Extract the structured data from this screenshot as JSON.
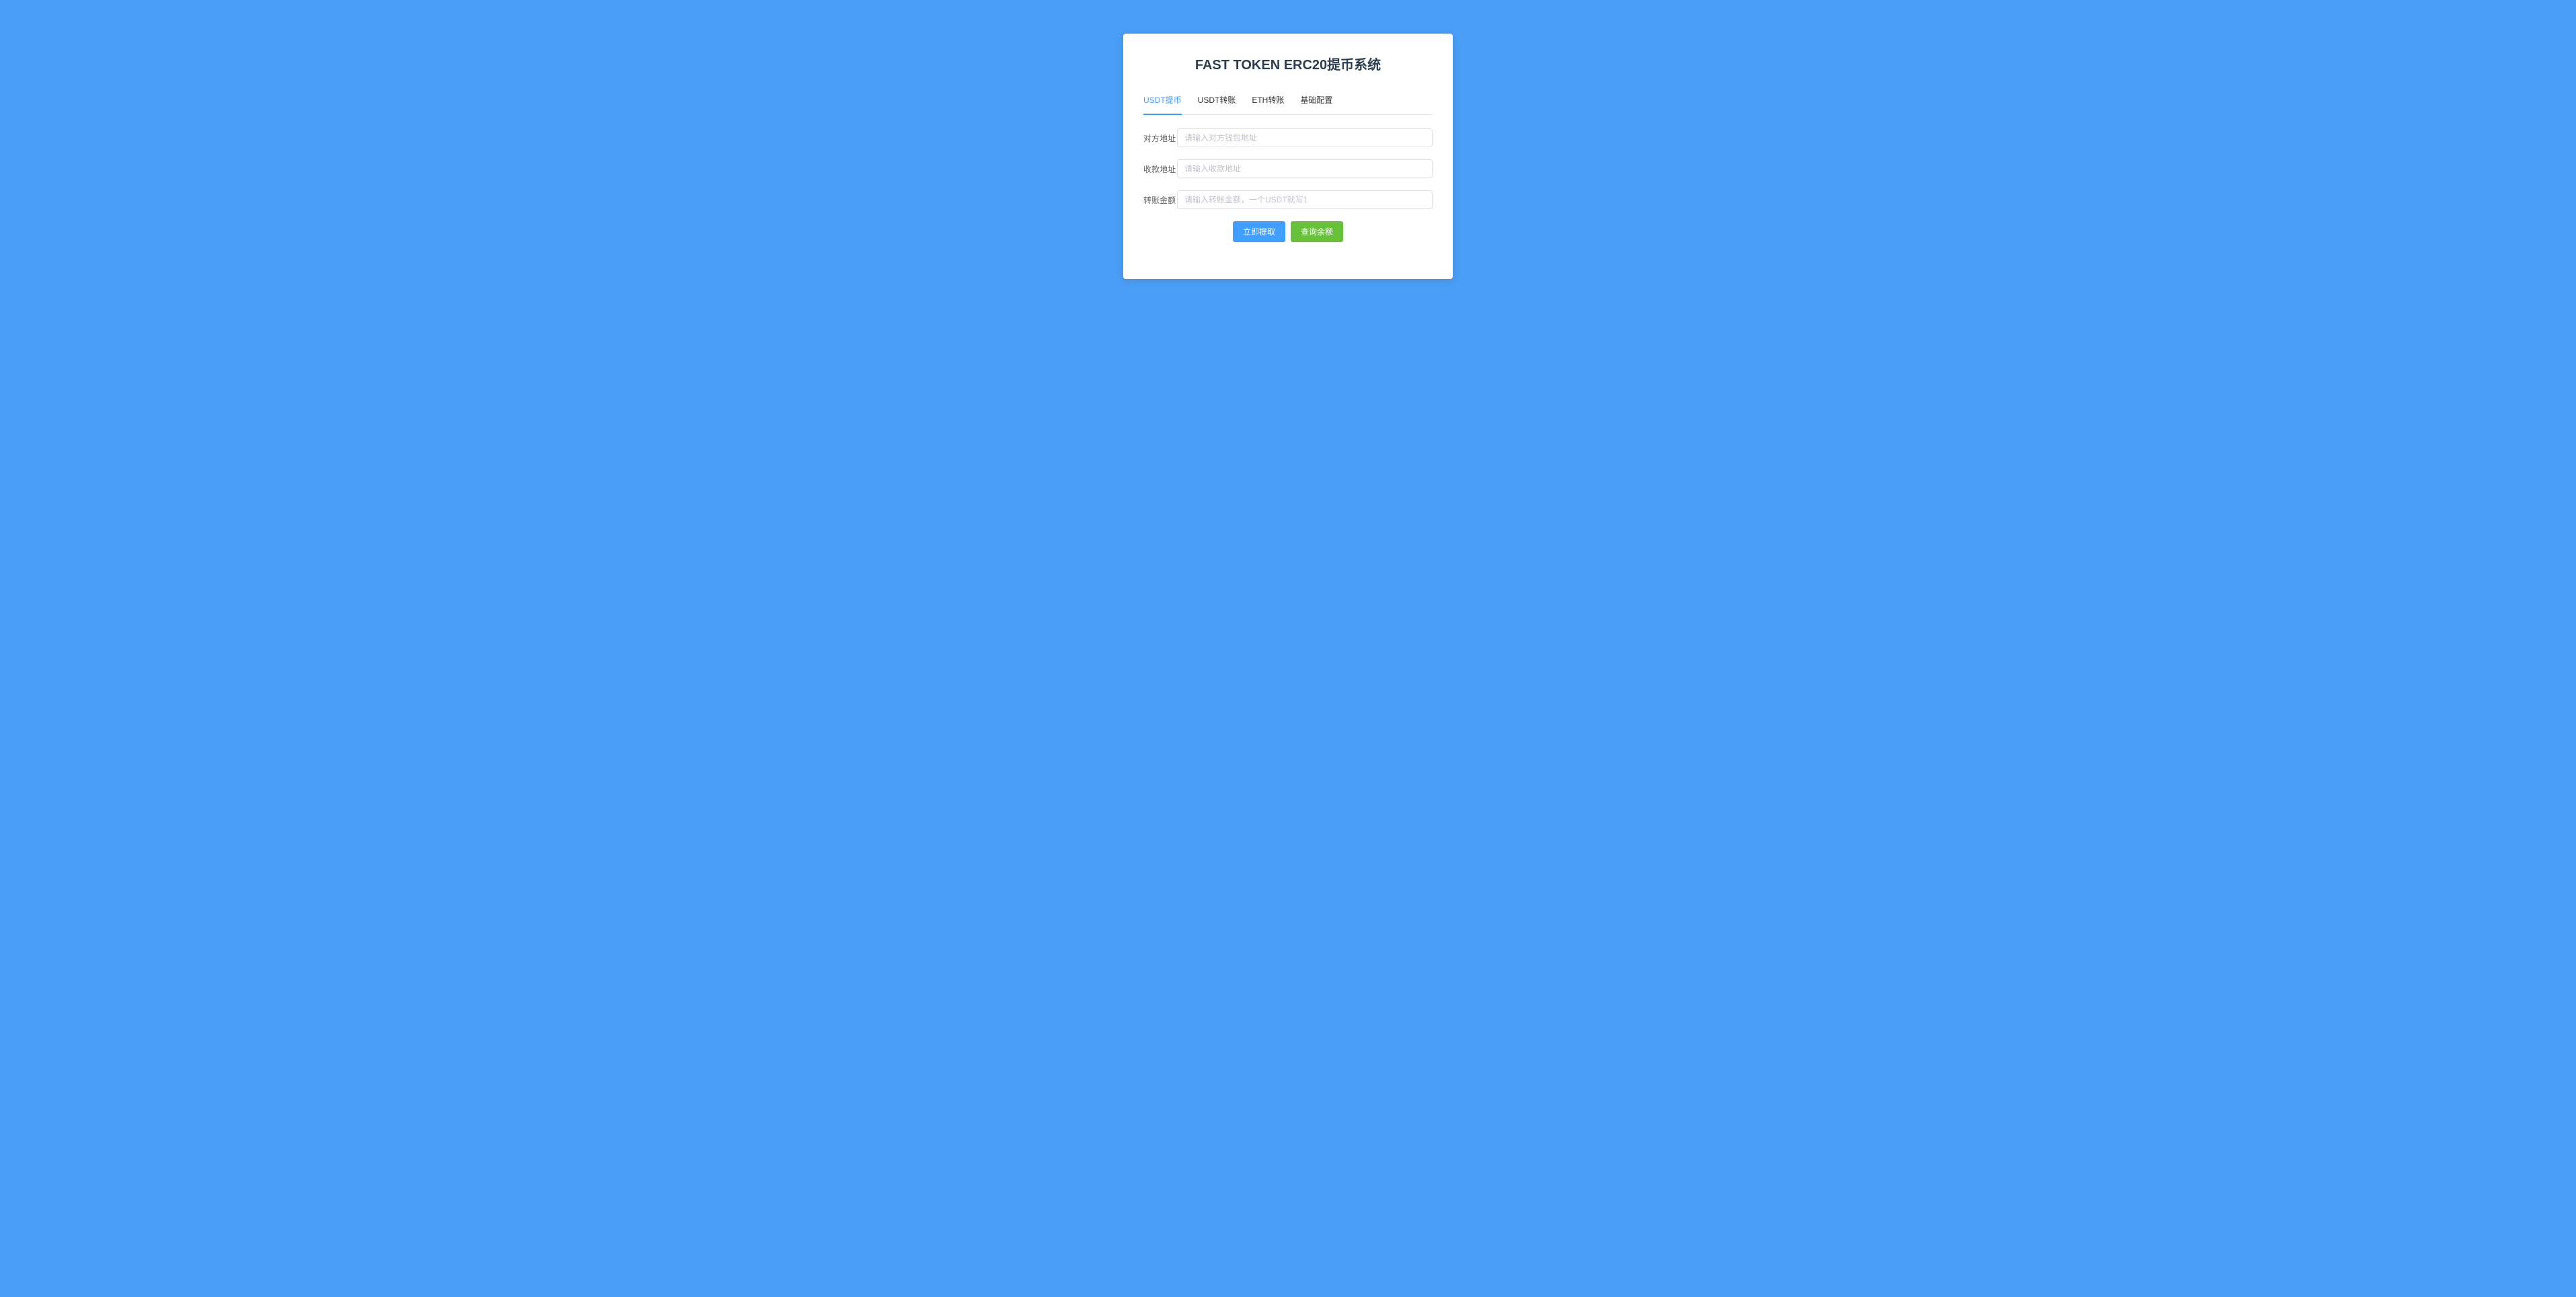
{
  "title": "FAST TOKEN ERC20提币系统",
  "tabs": [
    {
      "label": "USDT提币",
      "active": true
    },
    {
      "label": "USDT转账",
      "active": false
    },
    {
      "label": "ETH转账",
      "active": false
    },
    {
      "label": "基础配置",
      "active": false
    }
  ],
  "form": {
    "field1": {
      "label": "对方地址",
      "placeholder": "请输入对方钱包地址"
    },
    "field2": {
      "label": "收款地址",
      "placeholder": "请输入收款地址"
    },
    "field3": {
      "label": "转账金额",
      "placeholder": "请输入转账金额，一个USDT就写1"
    }
  },
  "buttons": {
    "submit": "立即提取",
    "query": "查询余额"
  }
}
